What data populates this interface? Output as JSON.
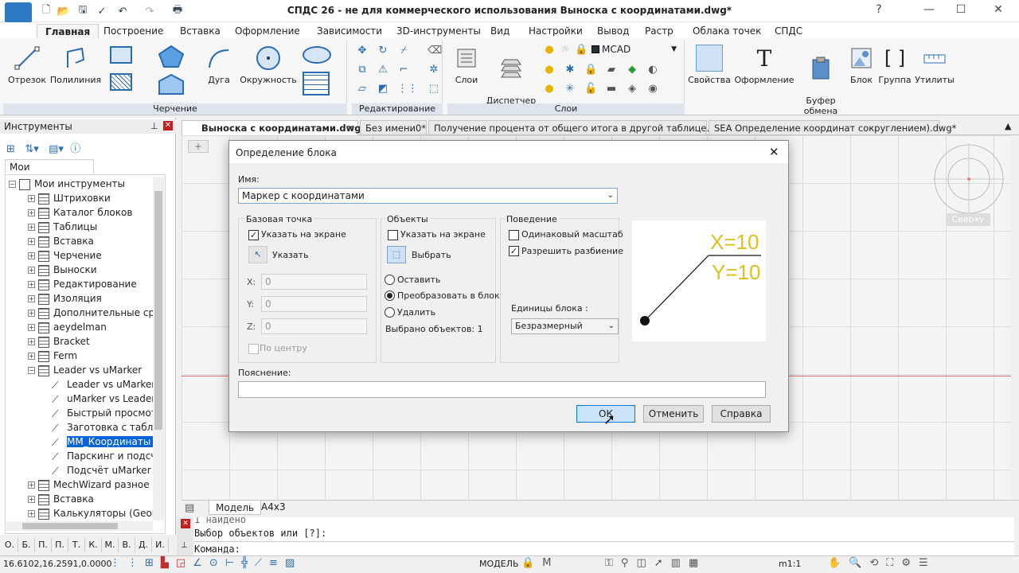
{
  "app": {
    "title": "СПДС 26 - не для коммерческого использования Выноска с координатами.dwg*"
  },
  "ribbon": {
    "tabs": [
      "Главная",
      "Построение",
      "Вставка",
      "Оформление",
      "Зависимости",
      "3D-инструменты",
      "Вид",
      "Настройки",
      "Вывод",
      "Растр",
      "Облака точек",
      "СПДС"
    ],
    "active_tab": "Главная",
    "draw_buttons": [
      "Отрезок",
      "Полилиния",
      "Дуга",
      "Окружность"
    ],
    "draw_group": "Черчение",
    "edit_group": "Редактирование",
    "layers_buttons": [
      "Слои",
      "Диспетчер\nслоёв"
    ],
    "layers_group": "Слои",
    "current_layer": "MCAD",
    "right_buttons": [
      "Свойства",
      "Оформление",
      "Буфер\nобмена",
      "Блок",
      "Группа",
      "Утилиты"
    ]
  },
  "tools_panel": {
    "title": "Инструменты",
    "tab": "Мои инструменты",
    "root": "Мои инструменты",
    "items": [
      {
        "label": "Штриховки",
        "level": 1
      },
      {
        "label": "Каталог блоков",
        "level": 1
      },
      {
        "label": "Таблицы",
        "level": 1
      },
      {
        "label": "Вставка",
        "level": 1
      },
      {
        "label": "Черчение",
        "level": 1
      },
      {
        "label": "Выноски",
        "level": 1
      },
      {
        "label": "Редактирование",
        "level": 1
      },
      {
        "label": "Изоляция",
        "level": 1
      },
      {
        "label": "Дополнительные сред",
        "level": 1
      },
      {
        "label": "aeydelman",
        "level": 1
      },
      {
        "label": "Bracket",
        "level": 1
      },
      {
        "label": "Ferm",
        "level": 1
      },
      {
        "label": "Leader vs uMarker",
        "level": 1
      },
      {
        "label": "Leader vs uMarker",
        "level": 2
      },
      {
        "label": "uMarker vs Leader",
        "level": 2
      },
      {
        "label": "Быстрый просмот",
        "level": 2
      },
      {
        "label": "Заготовка с табли",
        "level": 2
      },
      {
        "label": "MM_Координаты I",
        "level": 2
      },
      {
        "label": "Парскинг и подсч",
        "level": 2
      },
      {
        "label": "Подсчёт uMarker",
        "level": 2
      },
      {
        "label": "MechWizard разное",
        "level": 1
      },
      {
        "label": "Вставка",
        "level": 1
      },
      {
        "label": "Калькуляторы (Geoml",
        "level": 1
      }
    ],
    "bottom_letters": [
      "О.",
      "Б.",
      "П.",
      "П.",
      "Т.",
      "К.",
      "М.",
      "В.",
      "Д.",
      "И."
    ]
  },
  "doc_tabs": [
    "Выноска с координатами.dwg*",
    "Без имени0*",
    "Получение процента от общего итога в другой таблице.dwg*",
    "SEA Определение координат сокруглением).dwg*"
  ],
  "viewcube": {
    "label": "Сверху"
  },
  "layout_tabs": [
    "Модель",
    "A4x3"
  ],
  "command": {
    "lines": [
      "1 найдено",
      "Выбор объектов или [?]:"
    ],
    "prompt": "Команда:"
  },
  "status": {
    "coords": "16.6102,16.2591,0.0000",
    "mode": "МОДЕЛЬ",
    "scale": "m1:1"
  },
  "dialog": {
    "title": "Определение блока",
    "name_label": "Имя:",
    "name_value": "Маркер с координатами",
    "base": {
      "title": "Базовая точка",
      "on_screen": "Указать на экране",
      "pick": "Указать",
      "x_label": "X:",
      "x": "0",
      "y_label": "Y:",
      "y": "0",
      "z_label": "Z:",
      "z": "0",
      "center": "По центру"
    },
    "objects": {
      "title": "Объекты",
      "on_screen": "Указать на экране",
      "select": "Выбрать",
      "retain": "Оставить",
      "convert": "Преобразовать в блок",
      "delete": "Удалить",
      "selected": "Выбрано объектов: 1"
    },
    "behavior": {
      "title": "Поведение",
      "uniform": "Одинаковый масштаб",
      "explode": "Разрешить разбиение",
      "units_label": "Единицы блока :",
      "units_value": "Безразмерный"
    },
    "preview": {
      "x_text": "X=10",
      "y_text": "Y=10",
      "accent": "#d9c21e"
    },
    "desc_label": "Пояснение:",
    "ok": "ОК",
    "cancel": "Отменить",
    "help": "Справка"
  }
}
